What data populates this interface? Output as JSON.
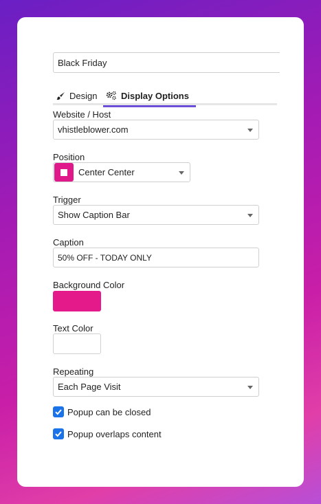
{
  "popup_name": "Black Friday",
  "tabs": [
    {
      "label": "Design",
      "icon": "brush-icon",
      "active": false
    },
    {
      "label": "Display Options",
      "icon": "gears-icon",
      "active": true
    }
  ],
  "website": {
    "label": "Website / Host",
    "value": "vhistleblower.com"
  },
  "position": {
    "label": "Position",
    "value": "Center Center",
    "swatch_color": "#e0198a"
  },
  "trigger": {
    "label": "Trigger",
    "value": "Show Caption Bar"
  },
  "caption": {
    "label": "Caption",
    "value": "50% OFF - TODAY ONLY"
  },
  "background_color": {
    "label": "Background Color",
    "value": "#e41a8a"
  },
  "text_color": {
    "label": "Text Color",
    "value": "#ffffff"
  },
  "repeating": {
    "label": "Repeating",
    "value": "Each Page Visit"
  },
  "checkboxes": [
    {
      "label": "Popup can be closed",
      "checked": true
    },
    {
      "label": "Popup overlaps content",
      "checked": true
    }
  ],
  "colors": {
    "accent": "#6b4fd8",
    "checkbox": "#1a73e8"
  }
}
